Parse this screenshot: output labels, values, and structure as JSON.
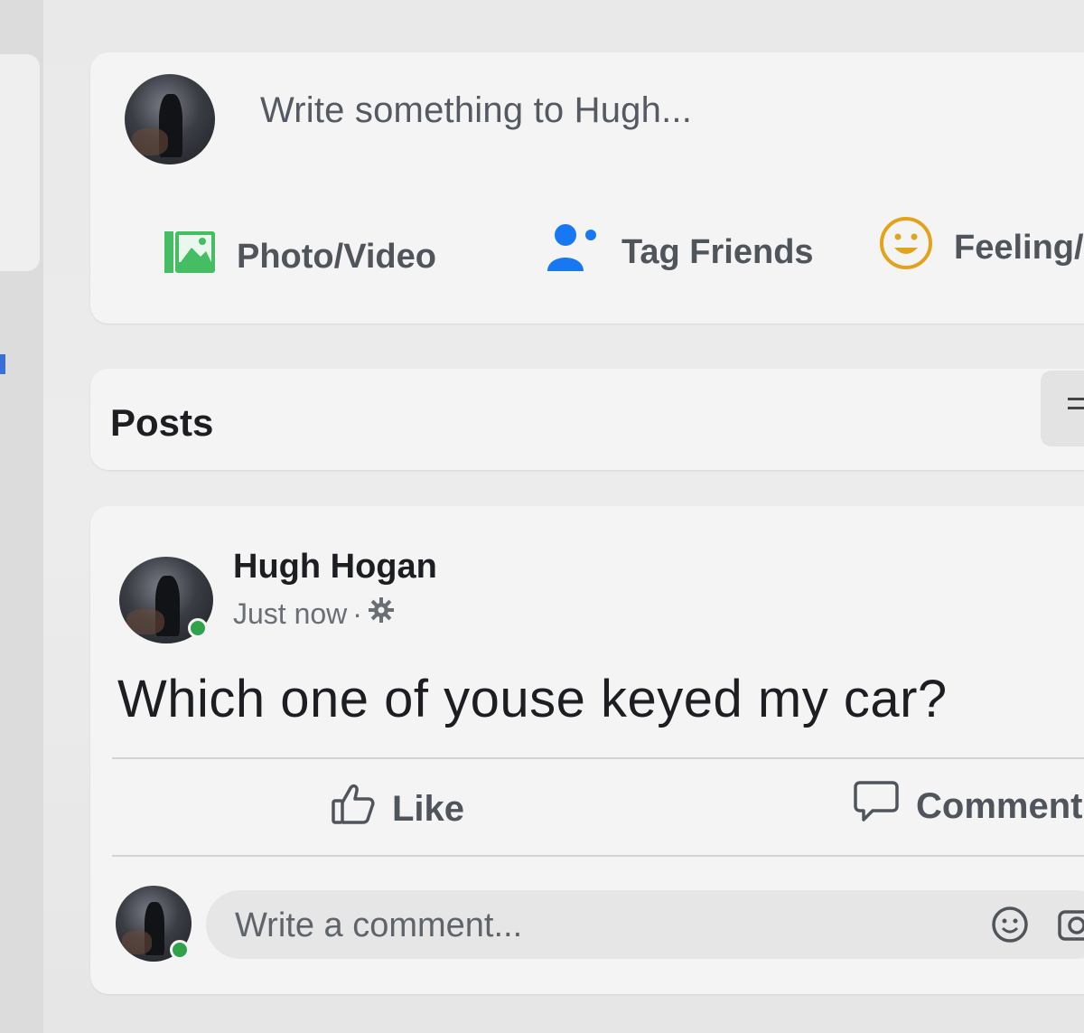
{
  "composer": {
    "placeholder": "Write something to Hugh...",
    "actions": [
      {
        "label": "Photo/Video",
        "icon": "photo-video-icon",
        "color": "#45bd62"
      },
      {
        "label": "Tag Friends",
        "icon": "tag-friends-icon",
        "color": "#1877f2"
      },
      {
        "label": "Feeling/",
        "icon": "feeling-icon",
        "color": "#f7b928"
      }
    ]
  },
  "posts_header": {
    "title": "Posts",
    "filter_icon": "filters-icon"
  },
  "post": {
    "author": "Hugh Hogan",
    "time": "Just now",
    "separator": "·",
    "privacy_icon": "gear-icon",
    "text": "Which one of youse keyed my car?",
    "like_label": "Like",
    "comment_label": "Comment",
    "comment_placeholder": "Write a comment...",
    "online_color": "#31a24c"
  }
}
